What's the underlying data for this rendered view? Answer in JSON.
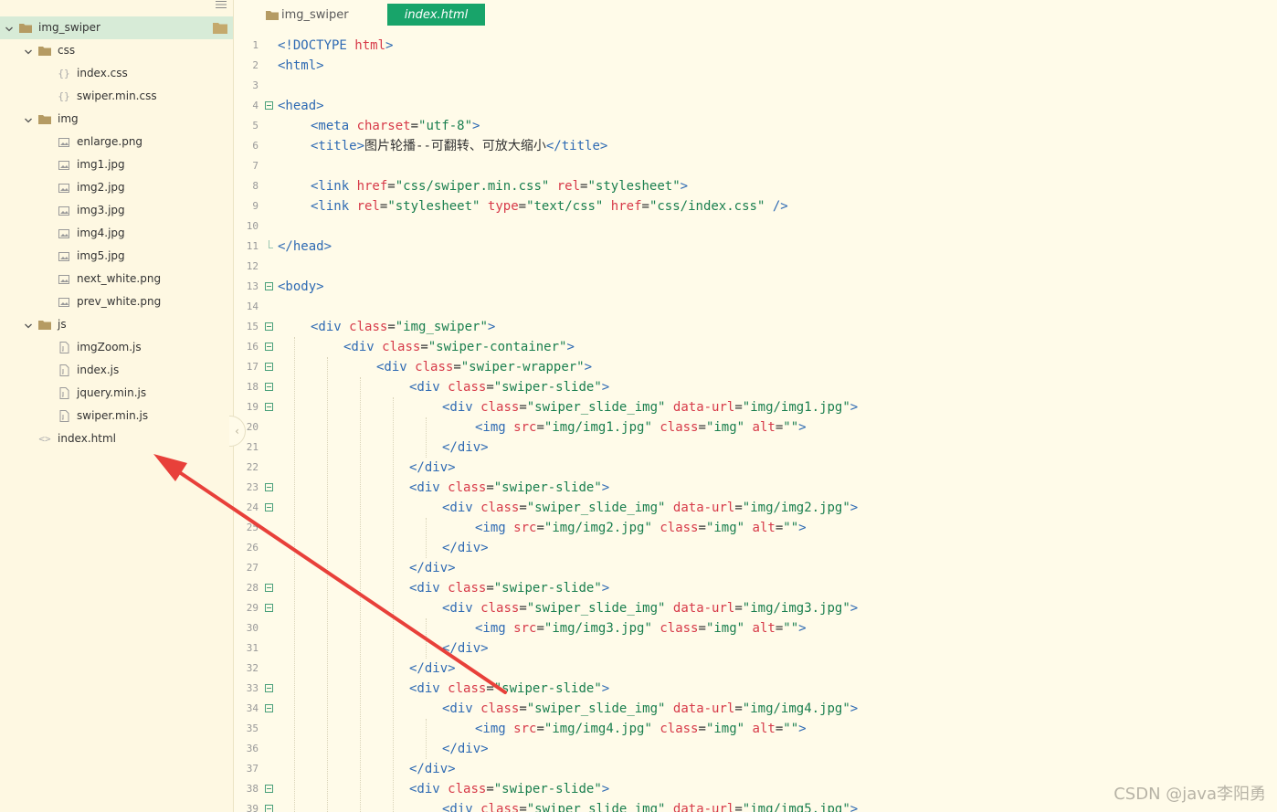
{
  "sidebar": {
    "items": [
      {
        "label": "img_swiper",
        "type": "folder",
        "depth": 0,
        "expanded": true,
        "selected": true
      },
      {
        "label": "css",
        "type": "folder",
        "depth": 1,
        "expanded": true
      },
      {
        "label": "index.css",
        "type": "css",
        "depth": 2
      },
      {
        "label": "swiper.min.css",
        "type": "css",
        "depth": 2
      },
      {
        "label": "img",
        "type": "folder",
        "depth": 1,
        "expanded": true
      },
      {
        "label": "enlarge.png",
        "type": "image",
        "depth": 2
      },
      {
        "label": "img1.jpg",
        "type": "image",
        "depth": 2
      },
      {
        "label": "img2.jpg",
        "type": "image",
        "depth": 2
      },
      {
        "label": "img3.jpg",
        "type": "image",
        "depth": 2
      },
      {
        "label": "img4.jpg",
        "type": "image",
        "depth": 2
      },
      {
        "label": "img5.jpg",
        "type": "image",
        "depth": 2
      },
      {
        "label": "next_white.png",
        "type": "image",
        "depth": 2
      },
      {
        "label": "prev_white.png",
        "type": "image",
        "depth": 2
      },
      {
        "label": "js",
        "type": "folder",
        "depth": 1,
        "expanded": true
      },
      {
        "label": "imgZoom.js",
        "type": "js",
        "depth": 2
      },
      {
        "label": "index.js",
        "type": "js",
        "depth": 2
      },
      {
        "label": "jquery.min.js",
        "type": "js",
        "depth": 2
      },
      {
        "label": "swiper.min.js",
        "type": "js",
        "depth": 2
      },
      {
        "label": "index.html",
        "type": "html",
        "depth": 1
      }
    ],
    "collapse_glyph": "‹"
  },
  "tabs": {
    "folder_tab": "img_swiper",
    "active_tab": "index.html"
  },
  "editor": {
    "lines": [
      {
        "n": "1",
        "fold": false,
        "indent": 0,
        "tokens": [
          [
            "tag",
            "<!DOCTYPE "
          ],
          [
            "attr",
            "html"
          ],
          [
            "tag",
            ">"
          ]
        ]
      },
      {
        "n": "2",
        "fold": false,
        "indent": 0,
        "tokens": [
          [
            "tag",
            "<html>"
          ]
        ]
      },
      {
        "n": "3",
        "fold": false,
        "indent": 0,
        "tokens": []
      },
      {
        "n": "4",
        "fold": true,
        "indent": 0,
        "tokens": [
          [
            "tag",
            "<head>"
          ]
        ]
      },
      {
        "n": "5",
        "fold": false,
        "indent": 1,
        "tokens": [
          [
            "tag",
            "<meta "
          ],
          [
            "attr",
            "charset"
          ],
          [
            "txt",
            "="
          ],
          [
            "str",
            "\"utf-8\""
          ],
          [
            "tag",
            ">"
          ]
        ]
      },
      {
        "n": "6",
        "fold": false,
        "indent": 1,
        "tokens": [
          [
            "tag",
            "<title>"
          ],
          [
            "txt",
            "图片轮播--可翻转、可放大缩小"
          ],
          [
            "tag",
            "</title>"
          ]
        ]
      },
      {
        "n": "7",
        "fold": false,
        "indent": 0,
        "tokens": []
      },
      {
        "n": "8",
        "fold": false,
        "indent": 1,
        "tokens": [
          [
            "tag",
            "<link "
          ],
          [
            "attr",
            "href"
          ],
          [
            "txt",
            "="
          ],
          [
            "str",
            "\"css/swiper.min.css\""
          ],
          [
            "txt",
            " "
          ],
          [
            "attr",
            "rel"
          ],
          [
            "txt",
            "="
          ],
          [
            "str",
            "\"stylesheet\""
          ],
          [
            "tag",
            ">"
          ]
        ]
      },
      {
        "n": "9",
        "fold": false,
        "indent": 1,
        "tokens": [
          [
            "tag",
            "<link "
          ],
          [
            "attr",
            "rel"
          ],
          [
            "txt",
            "="
          ],
          [
            "str",
            "\"stylesheet\""
          ],
          [
            "txt",
            " "
          ],
          [
            "attr",
            "type"
          ],
          [
            "txt",
            "="
          ],
          [
            "str",
            "\"text/css\""
          ],
          [
            "txt",
            " "
          ],
          [
            "attr",
            "href"
          ],
          [
            "txt",
            "="
          ],
          [
            "str",
            "\"css/index.css\""
          ],
          [
            "txt",
            " "
          ],
          [
            "tag",
            "/>"
          ]
        ]
      },
      {
        "n": "10",
        "fold": false,
        "indent": 0,
        "tokens": []
      },
      {
        "n": "11",
        "fold": false,
        "indent": 0,
        "tokens": [
          [
            "tag",
            "</head>"
          ]
        ]
      },
      {
        "n": "12",
        "fold": false,
        "indent": 0,
        "tokens": []
      },
      {
        "n": "13",
        "fold": true,
        "indent": 0,
        "tokens": [
          [
            "tag",
            "<body>"
          ]
        ]
      },
      {
        "n": "14",
        "fold": false,
        "indent": 0,
        "tokens": []
      },
      {
        "n": "15",
        "fold": true,
        "indent": 1,
        "tokens": [
          [
            "tag",
            "<div "
          ],
          [
            "attr",
            "class"
          ],
          [
            "txt",
            "="
          ],
          [
            "str",
            "\"img_swiper\""
          ],
          [
            "tag",
            ">"
          ]
        ]
      },
      {
        "n": "16",
        "fold": true,
        "indent": 2,
        "tokens": [
          [
            "tag",
            "<div "
          ],
          [
            "attr",
            "class"
          ],
          [
            "txt",
            "="
          ],
          [
            "str",
            "\"swiper-container\""
          ],
          [
            "tag",
            ">"
          ]
        ]
      },
      {
        "n": "17",
        "fold": true,
        "indent": 3,
        "tokens": [
          [
            "tag",
            "<div "
          ],
          [
            "attr",
            "class"
          ],
          [
            "txt",
            "="
          ],
          [
            "str",
            "\"swiper-wrapper\""
          ],
          [
            "tag",
            ">"
          ]
        ]
      },
      {
        "n": "18",
        "fold": true,
        "indent": 4,
        "tokens": [
          [
            "tag",
            "<div "
          ],
          [
            "attr",
            "class"
          ],
          [
            "txt",
            "="
          ],
          [
            "str",
            "\"swiper-slide\""
          ],
          [
            "tag",
            ">"
          ]
        ]
      },
      {
        "n": "19",
        "fold": true,
        "indent": 5,
        "tokens": [
          [
            "tag",
            "<div "
          ],
          [
            "attr",
            "class"
          ],
          [
            "txt",
            "="
          ],
          [
            "str",
            "\"swiper_slide_img\""
          ],
          [
            "txt",
            " "
          ],
          [
            "attr",
            "data-url"
          ],
          [
            "txt",
            "="
          ],
          [
            "str",
            "\"img/img1.jpg\""
          ],
          [
            "tag",
            ">"
          ]
        ]
      },
      {
        "n": "20",
        "fold": false,
        "indent": 6,
        "tokens": [
          [
            "tag",
            "<img "
          ],
          [
            "attr",
            "src"
          ],
          [
            "txt",
            "="
          ],
          [
            "str",
            "\"img/img1.jpg\""
          ],
          [
            "txt",
            " "
          ],
          [
            "attr",
            "class"
          ],
          [
            "txt",
            "="
          ],
          [
            "str",
            "\"img\""
          ],
          [
            "txt",
            " "
          ],
          [
            "attr",
            "alt"
          ],
          [
            "txt",
            "="
          ],
          [
            "str",
            "\"\""
          ],
          [
            "tag",
            ">"
          ]
        ]
      },
      {
        "n": "21",
        "fold": false,
        "indent": 5,
        "tokens": [
          [
            "tag",
            "</div>"
          ]
        ]
      },
      {
        "n": "22",
        "fold": false,
        "indent": 4,
        "tokens": [
          [
            "tag",
            "</div>"
          ]
        ]
      },
      {
        "n": "23",
        "fold": true,
        "indent": 4,
        "tokens": [
          [
            "tag",
            "<div "
          ],
          [
            "attr",
            "class"
          ],
          [
            "txt",
            "="
          ],
          [
            "str",
            "\"swiper-slide\""
          ],
          [
            "tag",
            ">"
          ]
        ]
      },
      {
        "n": "24",
        "fold": true,
        "indent": 5,
        "tokens": [
          [
            "tag",
            "<div "
          ],
          [
            "attr",
            "class"
          ],
          [
            "txt",
            "="
          ],
          [
            "str",
            "\"swiper_slide_img\""
          ],
          [
            "txt",
            " "
          ],
          [
            "attr",
            "data-url"
          ],
          [
            "txt",
            "="
          ],
          [
            "str",
            "\"img/img2.jpg\""
          ],
          [
            "tag",
            ">"
          ]
        ]
      },
      {
        "n": "25",
        "fold": false,
        "indent": 6,
        "tokens": [
          [
            "tag",
            "<img "
          ],
          [
            "attr",
            "src"
          ],
          [
            "txt",
            "="
          ],
          [
            "str",
            "\"img/img2.jpg\""
          ],
          [
            "txt",
            " "
          ],
          [
            "attr",
            "class"
          ],
          [
            "txt",
            "="
          ],
          [
            "str",
            "\"img\""
          ],
          [
            "txt",
            " "
          ],
          [
            "attr",
            "alt"
          ],
          [
            "txt",
            "="
          ],
          [
            "str",
            "\"\""
          ],
          [
            "tag",
            ">"
          ]
        ]
      },
      {
        "n": "26",
        "fold": false,
        "indent": 5,
        "tokens": [
          [
            "tag",
            "</div>"
          ]
        ]
      },
      {
        "n": "27",
        "fold": false,
        "indent": 4,
        "tokens": [
          [
            "tag",
            "</div>"
          ]
        ]
      },
      {
        "n": "28",
        "fold": true,
        "indent": 4,
        "tokens": [
          [
            "tag",
            "<div "
          ],
          [
            "attr",
            "class"
          ],
          [
            "txt",
            "="
          ],
          [
            "str",
            "\"swiper-slide\""
          ],
          [
            "tag",
            ">"
          ]
        ]
      },
      {
        "n": "29",
        "fold": true,
        "indent": 5,
        "tokens": [
          [
            "tag",
            "<div "
          ],
          [
            "attr",
            "class"
          ],
          [
            "txt",
            "="
          ],
          [
            "str",
            "\"swiper_slide_img\""
          ],
          [
            "txt",
            " "
          ],
          [
            "attr",
            "data-url"
          ],
          [
            "txt",
            "="
          ],
          [
            "str",
            "\"img/img3.jpg\""
          ],
          [
            "tag",
            ">"
          ]
        ]
      },
      {
        "n": "30",
        "fold": false,
        "indent": 6,
        "tokens": [
          [
            "tag",
            "<img "
          ],
          [
            "attr",
            "src"
          ],
          [
            "txt",
            "="
          ],
          [
            "str",
            "\"img/img3.jpg\""
          ],
          [
            "txt",
            " "
          ],
          [
            "attr",
            "class"
          ],
          [
            "txt",
            "="
          ],
          [
            "str",
            "\"img\""
          ],
          [
            "txt",
            " "
          ],
          [
            "attr",
            "alt"
          ],
          [
            "txt",
            "="
          ],
          [
            "str",
            "\"\""
          ],
          [
            "tag",
            ">"
          ]
        ]
      },
      {
        "n": "31",
        "fold": false,
        "indent": 5,
        "tokens": [
          [
            "tag",
            "</div>"
          ]
        ]
      },
      {
        "n": "32",
        "fold": false,
        "indent": 4,
        "tokens": [
          [
            "tag",
            "</div>"
          ]
        ]
      },
      {
        "n": "33",
        "fold": true,
        "indent": 4,
        "tokens": [
          [
            "tag",
            "<div "
          ],
          [
            "attr",
            "class"
          ],
          [
            "txt",
            "="
          ],
          [
            "str",
            "\"swiper-slide\""
          ],
          [
            "tag",
            ">"
          ]
        ]
      },
      {
        "n": "34",
        "fold": true,
        "indent": 5,
        "tokens": [
          [
            "tag",
            "<div "
          ],
          [
            "attr",
            "class"
          ],
          [
            "txt",
            "="
          ],
          [
            "str",
            "\"swiper_slide_img\""
          ],
          [
            "txt",
            " "
          ],
          [
            "attr",
            "data-url"
          ],
          [
            "txt",
            "="
          ],
          [
            "str",
            "\"img/img4.jpg\""
          ],
          [
            "tag",
            ">"
          ]
        ]
      },
      {
        "n": "35",
        "fold": false,
        "indent": 6,
        "tokens": [
          [
            "tag",
            "<img "
          ],
          [
            "attr",
            "src"
          ],
          [
            "txt",
            "="
          ],
          [
            "str",
            "\"img/img4.jpg\""
          ],
          [
            "txt",
            " "
          ],
          [
            "attr",
            "class"
          ],
          [
            "txt",
            "="
          ],
          [
            "str",
            "\"img\""
          ],
          [
            "txt",
            " "
          ],
          [
            "attr",
            "alt"
          ],
          [
            "txt",
            "="
          ],
          [
            "str",
            "\"\""
          ],
          [
            "tag",
            ">"
          ]
        ]
      },
      {
        "n": "36",
        "fold": false,
        "indent": 5,
        "tokens": [
          [
            "tag",
            "</div>"
          ]
        ]
      },
      {
        "n": "37",
        "fold": false,
        "indent": 4,
        "tokens": [
          [
            "tag",
            "</div>"
          ]
        ]
      },
      {
        "n": "38",
        "fold": true,
        "indent": 4,
        "tokens": [
          [
            "tag",
            "<div "
          ],
          [
            "attr",
            "class"
          ],
          [
            "txt",
            "="
          ],
          [
            "str",
            "\"swiper-slide\""
          ],
          [
            "tag",
            ">"
          ]
        ]
      },
      {
        "n": "39",
        "fold": true,
        "indent": 5,
        "tokens": [
          [
            "tag",
            "<div "
          ],
          [
            "attr",
            "class"
          ],
          [
            "txt",
            "="
          ],
          [
            "str",
            "\"swiper_slide_img\""
          ],
          [
            "txt",
            " "
          ],
          [
            "attr",
            "data-url"
          ],
          [
            "txt",
            "="
          ],
          [
            "str",
            "\"img/img5.jpg\""
          ],
          [
            "tag",
            ">"
          ]
        ]
      }
    ]
  },
  "watermark": "CSDN @java李阳勇",
  "colors": {
    "background": "#fffbe9",
    "sidebar": "#fef8e2",
    "selected_row": "#d7ebd7",
    "active_tab": "#18a46a",
    "tag": "#2e6ab3",
    "attr": "#d73a49",
    "string": "#1a7f4f",
    "arrow": "#e8403a"
  }
}
